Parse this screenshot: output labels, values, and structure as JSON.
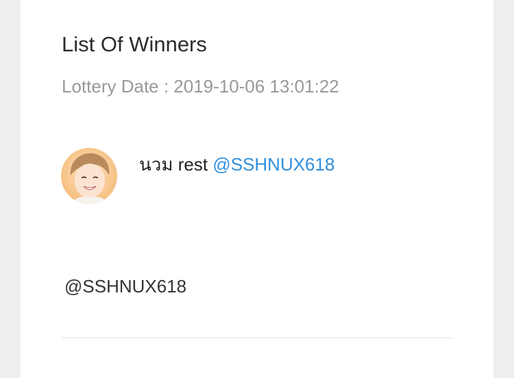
{
  "card": {
    "title": "List Of Winners",
    "lottery_date": "Lottery Date : 2019-10-06 13:01:22"
  },
  "winner": {
    "name": "นวม rest",
    "handle": "@SSHNUX618"
  },
  "comment": {
    "text": "@SSHNUX618"
  },
  "colors": {
    "link": "#2f8fdd",
    "muted": "#999999",
    "divider": "#e3e3e3"
  }
}
